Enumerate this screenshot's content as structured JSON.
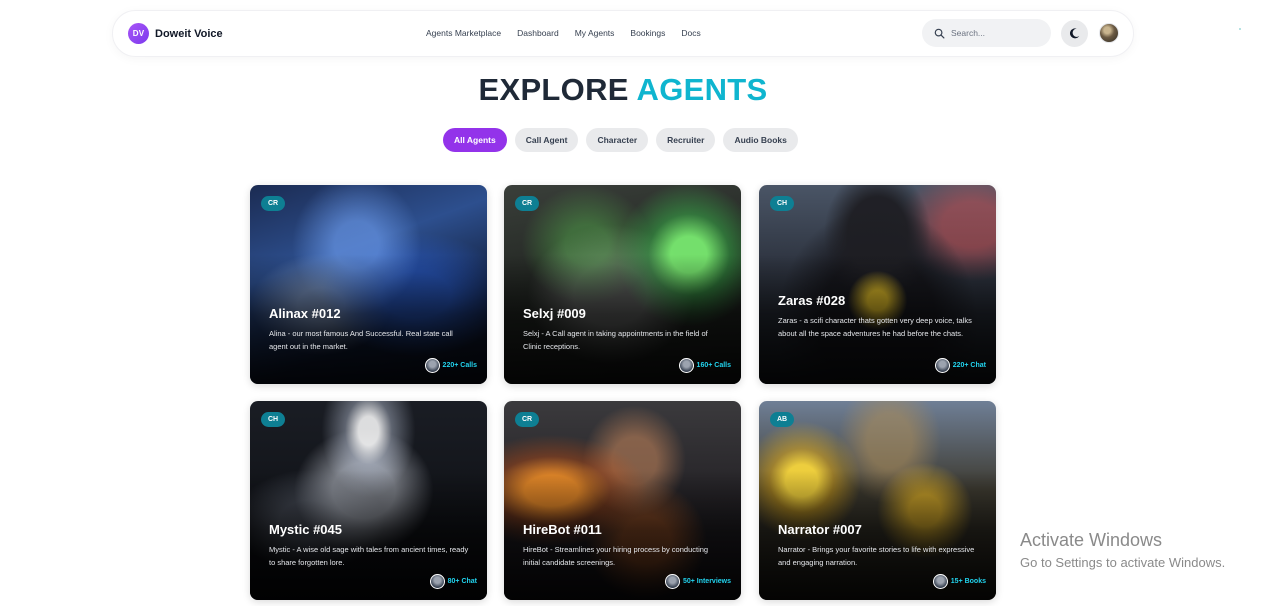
{
  "brand": {
    "logo_text": "DV",
    "name": "Doweit Voice"
  },
  "nav": {
    "links": [
      "Agents Marketplace",
      "Dashboard",
      "My Agents",
      "Bookings",
      "Docs"
    ]
  },
  "search": {
    "placeholder": "Search...",
    "value": ""
  },
  "title": {
    "part1": "EXPLORE",
    "part2": "AGENTS",
    "accent_color": "#0fb5cf"
  },
  "filters": {
    "active": "All Agents",
    "items": [
      "All Agents",
      "Call Agent",
      "Character",
      "Recruiter",
      "Audio Books"
    ],
    "active_color": "#9333ea"
  },
  "cards": [
    {
      "badge": "CR",
      "title": "Alinax #012",
      "description": "Alina - our most famous And Successful. Real state call agent out in the market.",
      "stat": "220+ Calls"
    },
    {
      "badge": "CR",
      "title": "Selxj #009",
      "description": "Selxj - A Call agent in taking appointments in the field of Clinic receptions.",
      "stat": "160+ Calls"
    },
    {
      "badge": "CH",
      "title": "Zaras #028",
      "description": "Zaras - a scifi character thats gotten very deep voice, talks about all the space adventures he had before the chats.",
      "stat": "220+ Chat"
    },
    {
      "badge": "CH",
      "title": "Mystic #045",
      "description": "Mystic - A wise old sage with tales from ancient times, ready to share forgotten lore.",
      "stat": "80+ Chat"
    },
    {
      "badge": "CR",
      "title": "HireBot #011",
      "description": "HireBot - Streamlines your hiring process by conducting initial candidate screenings.",
      "stat": "50+ Interviews"
    },
    {
      "badge": "AB",
      "title": "Narrator #007",
      "description": "Narrator - Brings your favorite stories to life with expressive and engaging narration.",
      "stat": "15+ Books"
    }
  ],
  "watermark": {
    "line1": "Activate Windows",
    "line2": "Go to Settings to activate Windows."
  }
}
